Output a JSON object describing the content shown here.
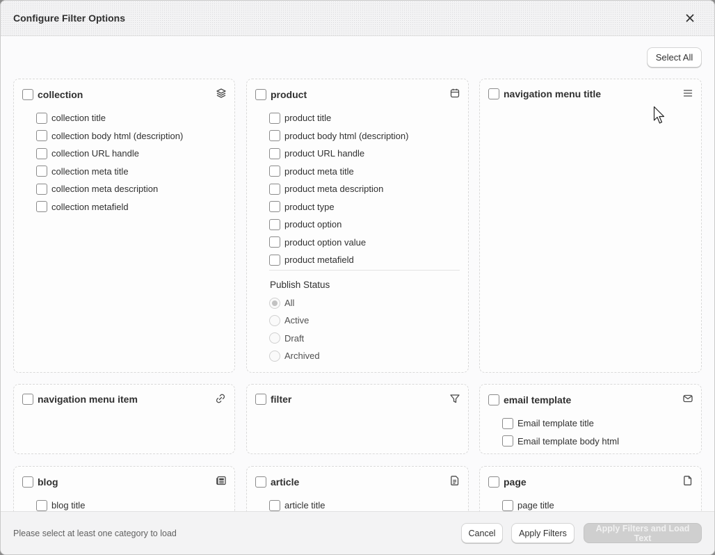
{
  "dialog": {
    "title": "Configure Filter Options",
    "close_icon": "close-icon",
    "select_all_label": "Select All"
  },
  "cards": {
    "collection": {
      "label": "collection",
      "icon": "layers-icon",
      "items": [
        "collection title",
        "collection body html (description)",
        "collection URL handle",
        "collection meta title",
        "collection meta description",
        "collection metafield"
      ]
    },
    "product": {
      "label": "product",
      "icon": "calendar-icon",
      "items": [
        "product title",
        "product body html (description)",
        "product URL handle",
        "product meta title",
        "product meta description",
        "product type",
        "product option",
        "product option value",
        "product metafield"
      ],
      "publish_status": {
        "title": "Publish Status",
        "options": [
          "All",
          "Active",
          "Draft",
          "Archived"
        ],
        "selected": "All"
      }
    },
    "navigation_menu_title": {
      "label": "navigation menu title",
      "icon": "menu-icon"
    },
    "navigation_menu_item": {
      "label": "navigation menu item",
      "icon": "link-icon"
    },
    "filter": {
      "label": "filter",
      "icon": "filter-icon"
    },
    "email_template": {
      "label": "email template",
      "icon": "mail-icon",
      "items": [
        "Email template title",
        "Email template body html"
      ]
    },
    "blog": {
      "label": "blog",
      "icon": "newspaper-icon",
      "items": [
        "blog title"
      ]
    },
    "article": {
      "label": "article",
      "icon": "document-icon",
      "items": [
        "article title"
      ]
    },
    "page": {
      "label": "page",
      "icon": "page-icon",
      "items": [
        "page title"
      ]
    }
  },
  "footer": {
    "hint": "Please select at least one category to load",
    "cancel_label": "Cancel",
    "apply_label": "Apply Filters",
    "apply_load_label": "Apply Filters and Load Text"
  },
  "colors": {
    "header_bg": "#f3f3f4",
    "card_border": "#d9d9d9",
    "disabled_button": "#cfcfcf"
  }
}
